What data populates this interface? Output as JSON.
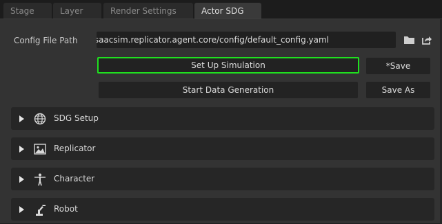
{
  "tabs": [
    {
      "label": "Stage"
    },
    {
      "label": "Layer"
    },
    {
      "label": "Render Settings"
    },
    {
      "label": "Actor SDG"
    }
  ],
  "active_tab": "Actor SDG",
  "config": {
    "label": "Config File Path",
    "value": "/isaacsim.replicator.agent.core/config/default_config.yaml",
    "folder_icon": "folder-icon",
    "export_icon": "share-export-icon"
  },
  "buttons": {
    "setup_simulation": "Set Up Simulation",
    "save": "*Save",
    "start_generation": "Start Data Generation",
    "save_as": "Save As"
  },
  "sections": [
    {
      "title": "SDG Setup",
      "icon": "globe-icon"
    },
    {
      "title": "Replicator",
      "icon": "image-icon"
    },
    {
      "title": "Character",
      "icon": "person-icon"
    },
    {
      "title": "Robot",
      "icon": "robot-arm-icon"
    }
  ],
  "colors": {
    "highlight": "#1fe01f",
    "panel": "#333333",
    "section": "#262626"
  }
}
